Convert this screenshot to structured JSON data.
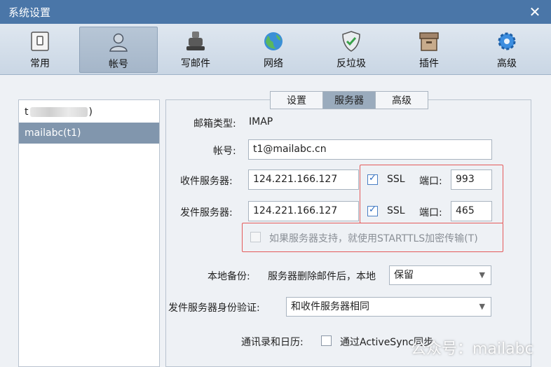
{
  "window": {
    "title": "系统设置",
    "close": "✕"
  },
  "toolbar": {
    "items": [
      {
        "label": "常用",
        "icon": "general-icon"
      },
      {
        "label": "帐号",
        "icon": "account-icon"
      },
      {
        "label": "写邮件",
        "icon": "compose-icon"
      },
      {
        "label": "网络",
        "icon": "network-globe-icon"
      },
      {
        "label": "反垃圾",
        "icon": "antispam-shield-icon"
      },
      {
        "label": "插件",
        "icon": "plugin-box-icon"
      },
      {
        "label": "高级",
        "icon": "advanced-gear-icon"
      }
    ],
    "active": "帐号"
  },
  "accounts": {
    "items": [
      {
        "prefix": "t",
        "suffix": ")"
      },
      {
        "label": "mailabc(t1)"
      }
    ],
    "selected": "mailabc(t1)"
  },
  "subtabs": {
    "items": [
      "设置",
      "服务器",
      "高级"
    ],
    "active": "服务器"
  },
  "form": {
    "mailbox_type_label": "邮箱类型:",
    "mailbox_type_value": "IMAP",
    "account_label": "帐号:",
    "account_value": "t1@mailabc.cn",
    "incoming_label": "收件服务器:",
    "incoming_value": "124.221.166.127",
    "incoming_ssl_label": "SSL",
    "incoming_ssl_checked": true,
    "incoming_port_label": "端口:",
    "incoming_port_value": "993",
    "outgoing_label": "发件服务器:",
    "outgoing_value": "124.221.166.127",
    "outgoing_ssl_label": "SSL",
    "outgoing_ssl_checked": true,
    "outgoing_port_label": "端口:",
    "outgoing_port_value": "465",
    "starttls_label": "如果服务器支持，就使用STARTTLS加密传输(T)",
    "starttls_checked": false,
    "backup_label": "本地备份:",
    "backup_desc": "服务器删除邮件后，本地",
    "backup_value": "保留",
    "smtp_auth_label": "发件服务器身份验证:",
    "smtp_auth_value": "和收件服务器相同",
    "contacts_label": "通讯录和日历:",
    "contacts_option": "通过ActiveSync同步",
    "contacts_checked": false
  },
  "watermark": "公众号：mailabc",
  "colors": {
    "titlebar": "#4a76a8",
    "selection": "#8196ad",
    "highlight_box": "#e45a5a",
    "checkbox_accent": "#2d6cc0"
  }
}
